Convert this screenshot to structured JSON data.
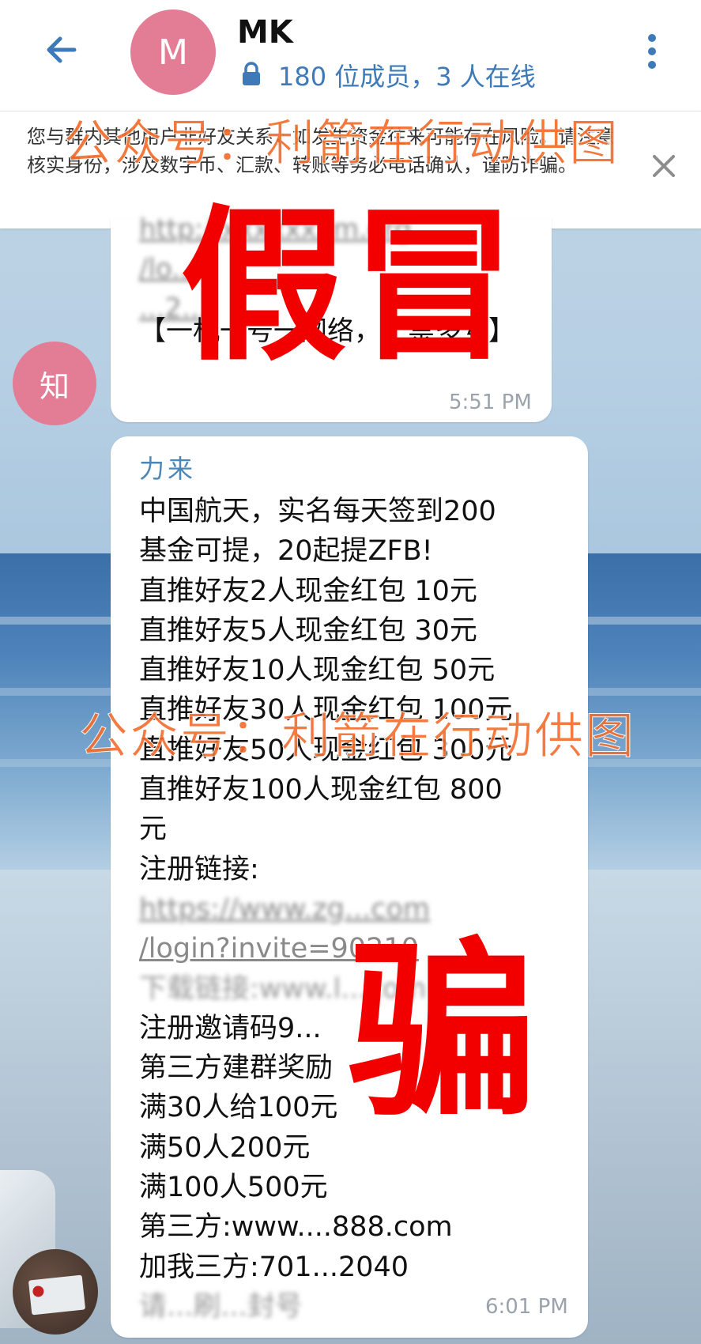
{
  "header": {
    "title": "MK",
    "avatar_letter": "M",
    "members_status": "180 位成员，3 人在线"
  },
  "notice": {
    "text": "您与群内其他用户非好友关系，如发生资金往来可能存在风险。请注意核实身份，涉及数字币、汇款、转账等务必电话确认，谨防诈骗。"
  },
  "message1": {
    "avatar_letter": "知",
    "link_line1": "http://xxxxxxxm.org",
    "link_line2": "/lo...",
    "link_line3": "...2...",
    "text": "【一机一号一网络，严禁多号】",
    "time": "5:51 PM"
  },
  "message2": {
    "sender": "力来",
    "lines": [
      "中国航天，实名每天签到200",
      "基金可提，20起提ZFB!",
      "直推好友2人现金红包 10元",
      "直推好友5人现金红包 30元",
      "直推好友10人现金红包 50元",
      "直推好友30人现金红包 100元",
      "直推好友50人现金红包 300元",
      "直推好友100人现金红包 800",
      "元",
      "注册链接:",
      "https://www.zg...com",
      "/login?invite=90210",
      "下载链接:www.l...com",
      "注册邀请码9...",
      "第三方建群奖励",
      "满30人给100元",
      "满50人200元",
      "满100人500元",
      "第三方:www....888.com",
      "加我三方:701...2040",
      "请...刷...封号"
    ],
    "time": "6:01 PM"
  },
  "watermarks": {
    "top": "公众号：利箭在行动供图",
    "middle": "公众号：利箭在行动供图",
    "stamp_fake": "假冒",
    "stamp_scam": "骗"
  },
  "colors": {
    "avatar": "#e37d96",
    "link_blue": "#3e7ab8",
    "stamp_red": "#f20000",
    "watermark_orange": "#f26d2e"
  },
  "icons": [
    "back-arrow-icon",
    "lock-icon",
    "more-vertical-icon",
    "close-icon"
  ]
}
